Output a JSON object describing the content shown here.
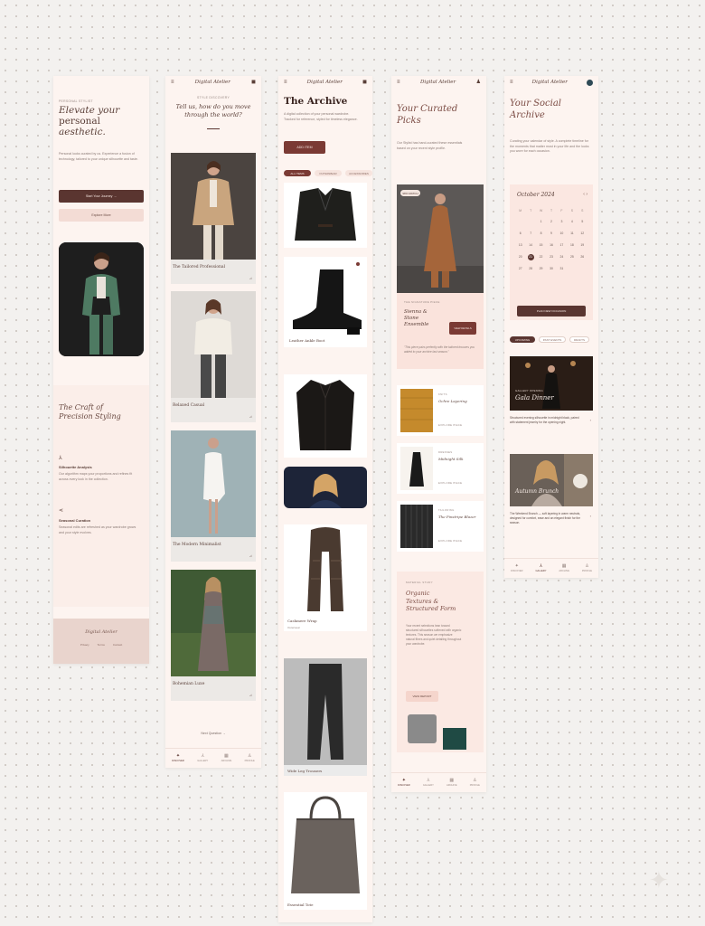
{
  "brand": "Digital Atelier",
  "screen1": {
    "eyebrow": "PERSONAL STYLIST",
    "headline_1": "Elevate your",
    "headline_2": "personal",
    "headline_3": "aesthetic.",
    "intro": "Personal looks curated by us. Experience a fusion of technology, tailored to your unique silhouette and taste.",
    "primary_cta": "Start Your Journey  →",
    "secondary_cta": "Explore More",
    "craft_title_1": "The Craft of",
    "craft_title_2": "Precision Styling",
    "feature_1_title": "Silhouette Analysis",
    "feature_1_text": "Our algorithm maps your proportions and refines fit across every look in the collection.",
    "feature_2_title": "Seasonal Curation",
    "feature_2_text": "Seasonal edits are refreshed as your wardrobe grows and your style evolves.",
    "footer_brand": "Digital Atelier",
    "footer_links": [
      "Privacy",
      "Terms",
      "Contact"
    ]
  },
  "screen2": {
    "eyebrow": "STYLE DISCOVERY",
    "question_1": "Tell us, how do you move",
    "question_2": "through the world?",
    "cards": [
      {
        "label": "The Tailored Professional"
      },
      {
        "label": "Relaxed Casual"
      },
      {
        "label": "The Modern Minimalist"
      },
      {
        "label": "Bohemian Luxe"
      }
    ],
    "next_label": "Next Question  →",
    "nav": [
      "DISCOVER",
      "GALLERY",
      "ARCHIVE",
      "PROFILE"
    ]
  },
  "screen3": {
    "title": "The Archive",
    "subtitle": "A digital collection of your personal wardrobe. Tracked for reference, styled for timeless elegance.",
    "add_label": "ADD ITEM",
    "filters": [
      "ALL ITEMS",
      "OUTERWEAR",
      "ACCESSORIES"
    ],
    "items": [
      {
        "label": ""
      },
      {
        "label": "Leather Ankle Boot"
      },
      {
        "label": ""
      },
      {
        "label": ""
      },
      {
        "label": "Cashmere Wrap"
      },
      {
        "label": "Wide Leg Trousers"
      },
      {
        "label": "Essential Tote"
      }
    ],
    "item_sub": "Outerwear"
  },
  "screen4": {
    "title_1": "Your Curated",
    "title_2": "Picks",
    "intro": "Our Stylist has hand-curated these essentials based on your recent style profile.",
    "match": "98% MATCH",
    "feature_eyebrow": "THE SIGNATURE PIECE",
    "feature_title_1": "Sienna &",
    "feature_title_2": "Stone",
    "feature_title_3": "Ensemble",
    "feature_btn": "VIEW DETAILS",
    "quote": "\"This piece pairs perfectly with the tailored trousers you added to your archive last season.\"",
    "products": [
      {
        "tag": "KNITS",
        "name": "Ochre Layering",
        "link": "EXPLORE PIECE"
      },
      {
        "tag": "DRESSES",
        "name": "Midnight Silk",
        "link": "EXPLORE PIECE"
      },
      {
        "tag": "TAILORING",
        "name": "The Pinstripe Blazer",
        "link": "EXPLORE PIECE"
      }
    ],
    "texture_eyebrow": "MATERIAL STUDY",
    "texture_title_1": "Organic",
    "texture_title_2": "Textures &",
    "texture_title_3": "Structured Form",
    "texture_text": "Your recent selections lean toward structured silhouettes softened with organic textures. This season we emphasize natural fibres and quiet detailing throughout your wardrobe.",
    "texture_btn": "VIEW REPORT",
    "nav": [
      "DISCOVER",
      "GALLERY",
      "ARCHIVE",
      "PROFILE"
    ]
  },
  "screen5": {
    "title_1": "Your Social",
    "title_2": "Archive",
    "intro": "Curating your calendar of style. A complete timeline for the moments that matter most in your life and the looks you wore for each occasion.",
    "month": "October 2024",
    "weekdays": [
      "M",
      "T",
      "W",
      "T",
      "F",
      "S",
      "S"
    ],
    "days": [
      "",
      "",
      "1",
      "2",
      "3",
      "4",
      "5",
      "6",
      "7",
      "8",
      "9",
      "10",
      "11",
      "12",
      "13",
      "14",
      "15",
      "16",
      "17",
      "18",
      "19",
      "20",
      "21",
      "22",
      "23",
      "24",
      "25",
      "26",
      "27",
      "28",
      "29",
      "30",
      "31"
    ],
    "selected_day": "21",
    "cta": "PLAN NEW OCCASION",
    "tabs": [
      "UPCOMING",
      "PAST EVENTS",
      "DRAFTS"
    ],
    "events": [
      {
        "eyebrow": "GALLERY OPENING",
        "title": "Gala Dinner",
        "desc": "Structured evening silhouette in midnight black, paired with statement jewelry for the opening night."
      },
      {
        "eyebrow": "",
        "title": "Autumn Brunch",
        "desc": "The Weekend Brunch — soft layering in warm neutrals, designed for comfort, ease and an elegant finish for the season."
      }
    ],
    "nav": [
      "DISCOVER",
      "GALLERY",
      "ARCHIVE",
      "PROFILE"
    ]
  },
  "colors": {
    "accent": "#5a3530",
    "background": "#f3f1ef",
    "screen_bg": "#fdf4f0",
    "soft_pink": "#f3dcd5"
  }
}
